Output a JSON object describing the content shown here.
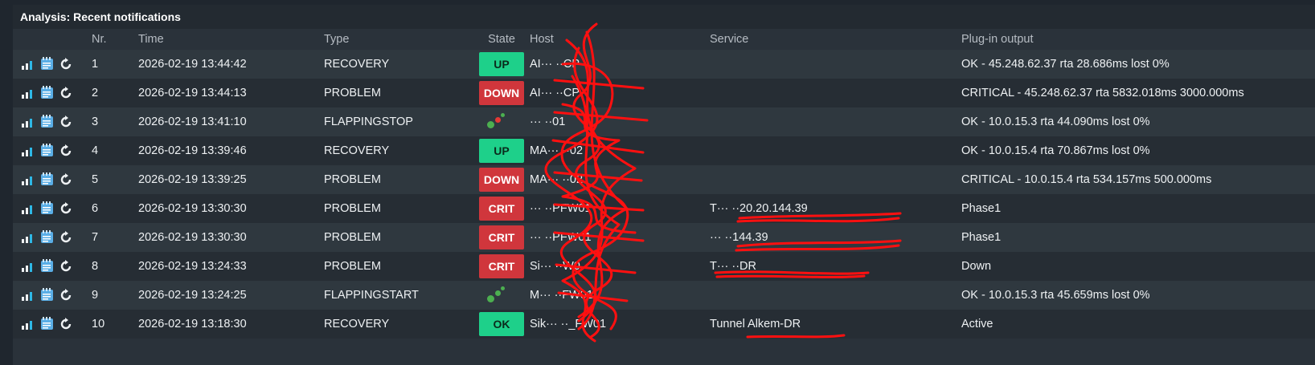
{
  "dashlet": {
    "title": "Analysis: Recent notifications"
  },
  "columns": {
    "nr": "Nr.",
    "time": "Time",
    "type": "Type",
    "state": "State",
    "host": "Host",
    "service": "Service",
    "output": "Plug-in output"
  },
  "row_icons": [
    "graph-icon",
    "notes-icon",
    "reload-icon"
  ],
  "colors": {
    "up": "#1ed08a",
    "down": "#d0363c",
    "graph_icon": "#2eb8e6"
  },
  "rows": [
    {
      "nr": "1",
      "time": "2026-02-19 13:44:42",
      "type": "RECOVERY",
      "state": "UP",
      "state_kind": "up",
      "host": "AI··· ··CP",
      "service": "",
      "output": "OK - 45.248.62.37 rta 28.686ms lost 0%"
    },
    {
      "nr": "2",
      "time": "2026-02-19 13:44:13",
      "type": "PROBLEM",
      "state": "DOWN",
      "state_kind": "down",
      "host": "AI··· ··CP",
      "service": "",
      "output": "CRITICAL - 45.248.62.37 rta 5832.018ms 3000.000ms"
    },
    {
      "nr": "3",
      "time": "2026-02-19 13:41:10",
      "type": "FLAPPINGSTOP",
      "state": "",
      "state_kind": "flap-stop",
      "host": "··· ··01",
      "service": "",
      "output": "OK - 10.0.15.3 rta 44.090ms lost 0%"
    },
    {
      "nr": "4",
      "time": "2026-02-19 13:39:46",
      "type": "RECOVERY",
      "state": "UP",
      "state_kind": "up",
      "host": "MA··· ··02",
      "service": "",
      "output": "OK - 10.0.15.4 rta 70.867ms lost 0%"
    },
    {
      "nr": "5",
      "time": "2026-02-19 13:39:25",
      "type": "PROBLEM",
      "state": "DOWN",
      "state_kind": "down",
      "host": "MA··· ··02",
      "service": "",
      "output": "CRITICAL - 10.0.15.4 rta 534.157ms 500.000ms"
    },
    {
      "nr": "6",
      "time": "2026-02-19 13:30:30",
      "type": "PROBLEM",
      "state": "CRIT",
      "state_kind": "crit",
      "host": "··· ··PFW01",
      "service": "T··· ··20.20.144.39",
      "output": "Phase1"
    },
    {
      "nr": "7",
      "time": "2026-02-19 13:30:30",
      "type": "PROBLEM",
      "state": "CRIT",
      "state_kind": "crit",
      "host": "··· ··PFW01",
      "service": "··· ··144.39",
      "output": "Phase1"
    },
    {
      "nr": "8",
      "time": "2026-02-19 13:24:33",
      "type": "PROBLEM",
      "state": "CRIT",
      "state_kind": "crit",
      "host": "Si··· ··W0",
      "service": "T··· ··DR",
      "output": "Down"
    },
    {
      "nr": "9",
      "time": "2026-02-19 13:24:25",
      "type": "FLAPPINGSTART",
      "state": "",
      "state_kind": "flap-start",
      "host": "M··· ··FW01",
      "service": "",
      "output": "OK - 10.0.15.3 rta 45.659ms lost 0%"
    },
    {
      "nr": "10",
      "time": "2026-02-19 13:18:30",
      "type": "RECOVERY",
      "state": "OK",
      "state_kind": "ok",
      "host": "Sik··· ··_FW01",
      "service": "Tunnel Alkem-DR",
      "output": "Active"
    }
  ]
}
